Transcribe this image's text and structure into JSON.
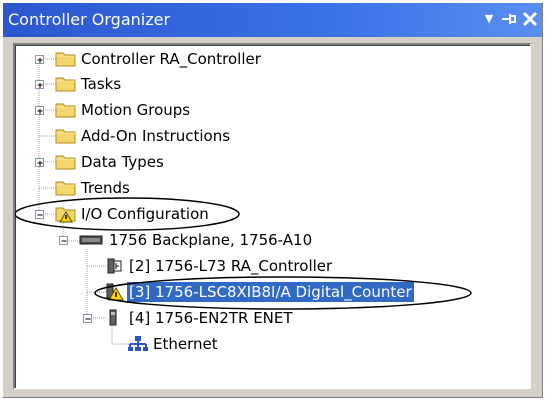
{
  "window": {
    "title": "Controller Organizer",
    "buttons": {
      "menu": "▼",
      "pin": "⊣",
      "close": "✕"
    }
  },
  "colors": {
    "title_bar": "#3a71e8",
    "selection": "#316ac5",
    "folder": "#f3d56b",
    "callout": "#000000"
  },
  "tree": {
    "items": [
      {
        "label": "Controller RA_Controller",
        "icon": "folder-icon",
        "expander": "+"
      },
      {
        "label": "Tasks",
        "icon": "folder-icon",
        "expander": "+"
      },
      {
        "label": "Motion Groups",
        "icon": "folder-icon",
        "expander": "+"
      },
      {
        "label": "Add-On Instructions",
        "icon": "folder-icon",
        "expander": ""
      },
      {
        "label": "Data Types",
        "icon": "folder-icon",
        "expander": "+"
      },
      {
        "label": "Trends",
        "icon": "folder-icon",
        "expander": ""
      },
      {
        "label": "I/O Configuration",
        "icon": "folder-warning-icon",
        "expander": "-",
        "circled": true
      },
      {
        "label": "1756 Backplane, 1756-A10",
        "icon": "backplane-icon",
        "expander": "-"
      },
      {
        "label": "[2] 1756-L73 RA_Controller",
        "icon": "controller-module-icon",
        "expander": ""
      },
      {
        "label": "[3] 1756-LSC8XIB8I/A Digital_Counter",
        "icon": "module-warning-icon",
        "expander": "",
        "selected": true,
        "circled": true
      },
      {
        "label": "[4] 1756-EN2TR ENET",
        "icon": "ethernet-module-icon",
        "expander": "-"
      },
      {
        "label": "Ethernet",
        "icon": "network-icon",
        "expander": ""
      }
    ]
  }
}
